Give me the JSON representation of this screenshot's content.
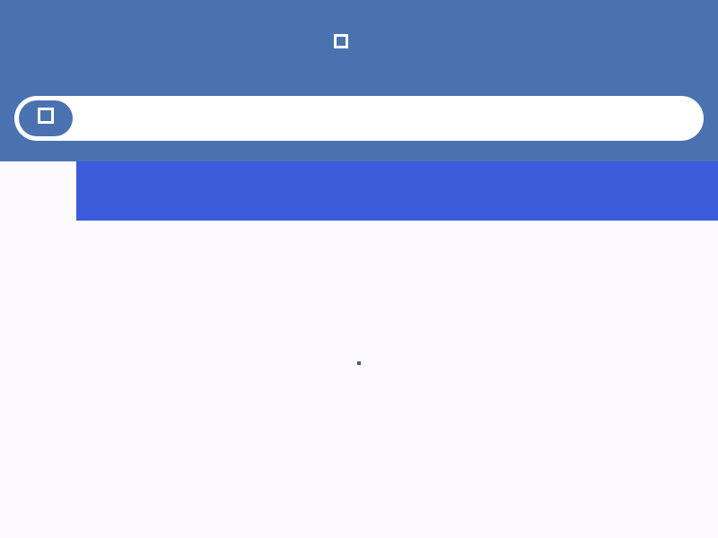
{
  "header": {
    "title_left": "",
    "title_icon": "square-icon",
    "title_right": "",
    "subtitle": ""
  },
  "search": {
    "button_icon": "square-icon",
    "words": [
      "",
      "",
      "",
      ""
    ]
  },
  "nav": {
    "brand_line1": "",
    "brand_line2": "",
    "tabs": [
      {
        "label": "",
        "active": true
      },
      {
        "label": "",
        "active": false
      },
      {
        "label": "",
        "active": false
      },
      {
        "label": "",
        "active": false
      },
      {
        "label": "",
        "active": false
      }
    ]
  },
  "main": {
    "loading_indicator": "loading-dot"
  },
  "colors": {
    "header_bg": "#4a72b0",
    "nav_bg": "#3c5cdb",
    "page_bg": "#fdfafd",
    "text_dark": "#1b1b1f",
    "tab_inactive": "#9a9aa8",
    "tab_active": "#ffffff"
  }
}
